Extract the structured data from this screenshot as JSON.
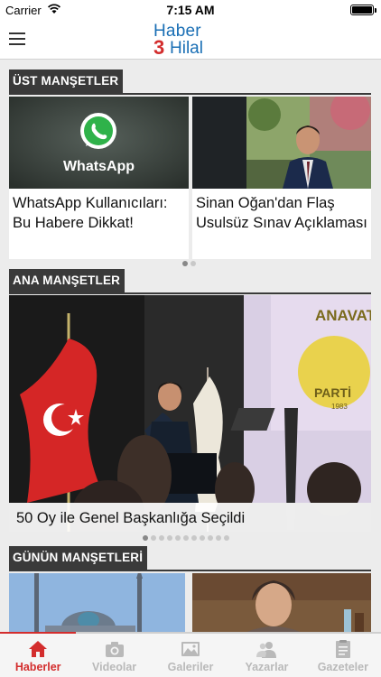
{
  "status_bar": {
    "carrier": "Carrier",
    "time": "7:15 AM"
  },
  "header": {
    "logo_line1": "Haber",
    "logo_number": "3",
    "logo_line2": "Hilal"
  },
  "sections": {
    "ust": {
      "title": "ÜST MANŞETLER",
      "cards": [
        {
          "image_text": "WhatsApp",
          "caption": "WhatsApp Kullanıcıları: Bu Habere Dikkat!"
        },
        {
          "caption": "Sinan Oğan'dan Flaş Usulsüz Sınav Açıklaması"
        }
      ]
    },
    "ana": {
      "title": "ANA MANŞETLER",
      "caption": "50 Oy ile Genel Başkanlığa Seçildi",
      "banner_text_1": "ANAVAT",
      "banner_text_2": "PARTİ",
      "banner_text_3": "1983"
    },
    "gunun": {
      "title": "GÜNÜN MANŞETLERİ"
    }
  },
  "tabs": [
    {
      "label": "Haberler",
      "icon": "home-icon"
    },
    {
      "label": "Videolar",
      "icon": "camera-icon"
    },
    {
      "label": "Galeriler",
      "icon": "gallery-icon"
    },
    {
      "label": "Yazarlar",
      "icon": "users-icon"
    },
    {
      "label": "Gazeteler",
      "icon": "newspaper-icon"
    }
  ],
  "colors": {
    "accent": "#d32d2d",
    "logo_blue": "#1a6fb5",
    "section_bg": "#3a3a3a"
  }
}
